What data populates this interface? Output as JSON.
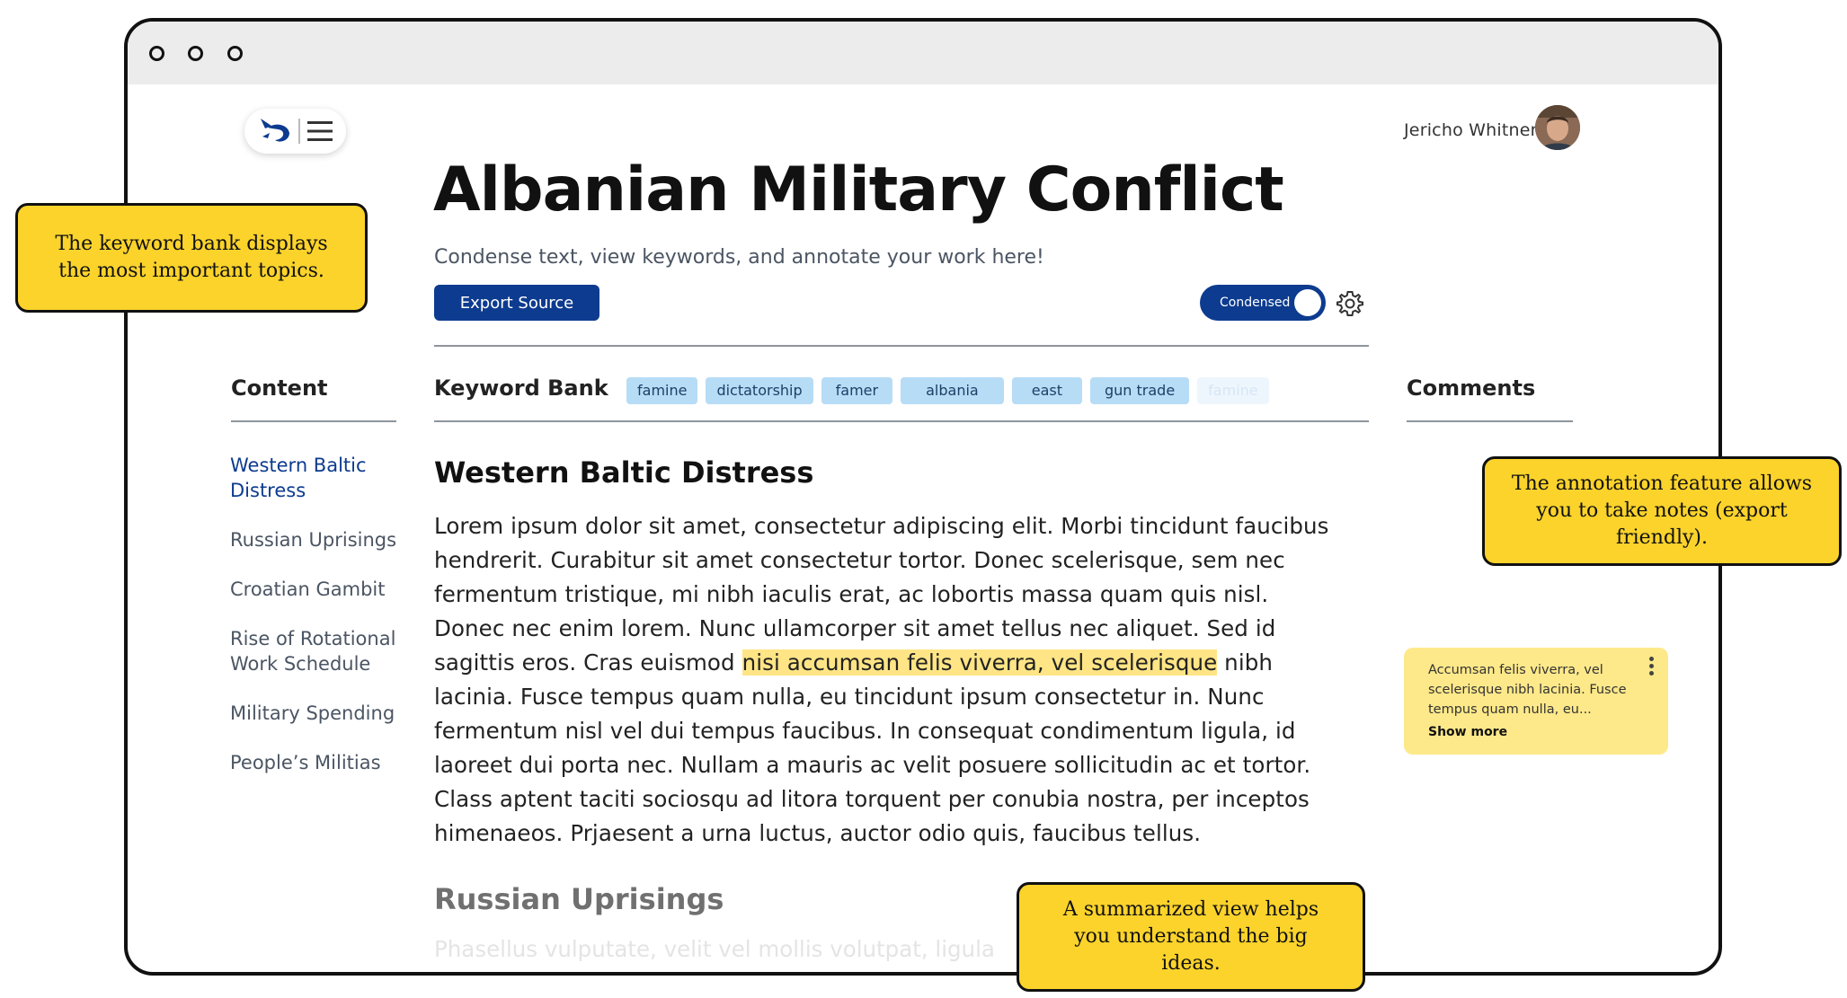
{
  "user": {
    "name": "Jericho Whitner"
  },
  "page": {
    "title": "Albanian Military Conflict",
    "subtitle": "Condense text, view keywords, and annotate your work here!"
  },
  "toolbar": {
    "export_label": "Export Source",
    "toggle_label": "Condensed",
    "toggle_on": true
  },
  "columns": {
    "content": "Content",
    "keyword_bank": "Keyword Bank",
    "comments": "Comments"
  },
  "keywords": [
    "famine",
    "dictatorship",
    "famer",
    "albania",
    "east",
    "gun trade",
    "famine"
  ],
  "toc": [
    "Western Baltic Distress",
    "Russian Uprisings",
    "Croatian Gambit",
    "Rise of Rotational Work Schedule",
    "Military Spending",
    "People’s Militias"
  ],
  "sections": [
    {
      "title": "Western Baltic Distress",
      "lines": [
        "Lorem ipsum dolor sit amet, consectetur adipiscing elit. Morbi tincidunt faucibus",
        "hendrerit. Curabitur sit amet consectetur tortor. Donec scelerisque, sem nec",
        "fermentum tristique, mi nibh iaculis erat, ac lobortis massa quam quis nisl.",
        "Donec nec enim lorem. Nunc ullamcorper sit amet tellus nec aliquet. Sed id"
      ],
      "highlight_line": {
        "before": "sagittis eros. Cras euismod ",
        "highlight": "nisi accumsan felis viverra, vel scelerisque",
        "after": " nibh"
      },
      "lines_after": [
        "lacinia. Fusce tempus quam nulla, eu tincidunt ipsum consectetur in. Nunc",
        "fermentum nisl vel dui tempus faucibus. In consequat condimentum ligula, id",
        "laoreet dui porta nec. Nullam a mauris ac velit posuere sollicitudin ac et tortor.",
        "Class aptent taciti sociosqu ad litora torquent per conubia nostra, per inceptos",
        "himenaeos. Prjaesent a urna luctus, auctor odio quis, faucibus tellus."
      ]
    },
    {
      "title": "Russian Uprisings",
      "preview": "Phasellus vulputate, velit vel mollis volutpat, ligula"
    }
  ],
  "comment": {
    "text": "Accumsan felis viverra, vel scelerisque nibh lacinia. Fusce tempus quam nulla, eu...",
    "show_more": "Show more"
  },
  "callouts": {
    "keyword_bank": "The keyword bank displays the most important topics.",
    "annotation": "The annotation feature allows you to take notes (export friendly).",
    "summary": "A summarized view helps you understand the big ideas."
  },
  "colors": {
    "primary": "#0d3b8f",
    "keyword_chip": "#b7dcf6",
    "highlight": "#ffe585",
    "comment_card": "#fee98a",
    "callout": "#fbd32b"
  },
  "icons": [
    "app-logo-icon",
    "hamburger-menu-icon",
    "gear-icon",
    "kebab-menu-icon"
  ]
}
